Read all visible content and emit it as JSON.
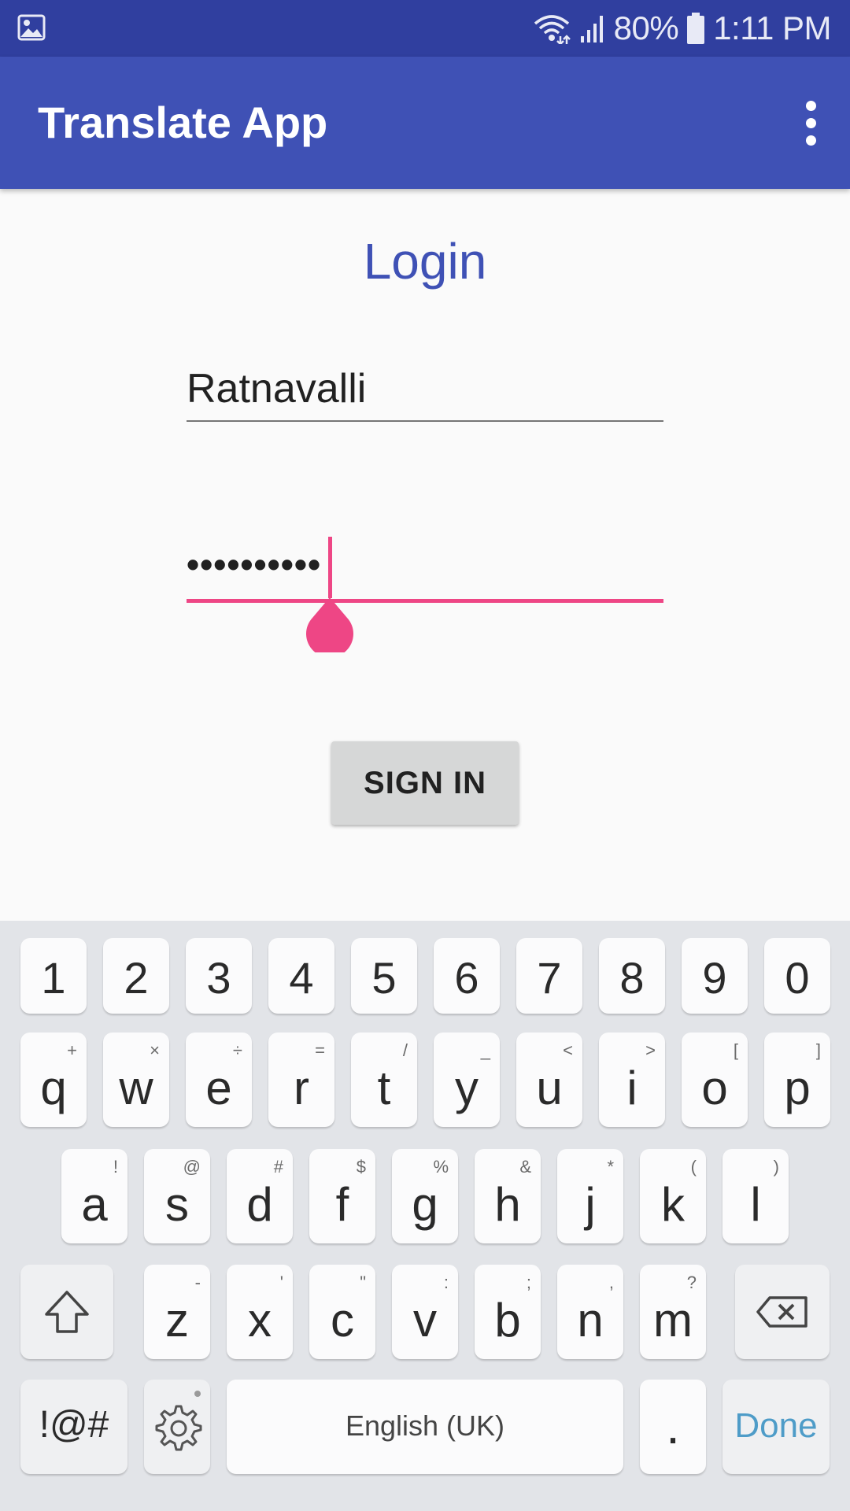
{
  "status_bar": {
    "battery": "80%",
    "time": "1:11 PM",
    "icons": [
      "image-icon",
      "wifi-icon",
      "signal-icon",
      "battery-icon"
    ]
  },
  "app_bar": {
    "title": "Translate App",
    "menu_icon": "more-vert-icon"
  },
  "login": {
    "title": "Login",
    "username_value": "Ratnavalli",
    "password_value": "••••••••••",
    "sign_in_label": "SIGN IN",
    "accent_color": "#ee4685",
    "primary_color": "#3f51b5"
  },
  "keyboard": {
    "numbers": [
      "1",
      "2",
      "3",
      "4",
      "5",
      "6",
      "7",
      "8",
      "9",
      "0"
    ],
    "row1": [
      {
        "key": "q",
        "hint": "+"
      },
      {
        "key": "w",
        "hint": "×"
      },
      {
        "key": "e",
        "hint": "÷"
      },
      {
        "key": "r",
        "hint": "="
      },
      {
        "key": "t",
        "hint": "/"
      },
      {
        "key": "y",
        "hint": "_"
      },
      {
        "key": "u",
        "hint": "<"
      },
      {
        "key": "i",
        "hint": ">"
      },
      {
        "key": "o",
        "hint": "["
      },
      {
        "key": "p",
        "hint": "]"
      }
    ],
    "row2": [
      {
        "key": "a",
        "hint": "!"
      },
      {
        "key": "s",
        "hint": "@"
      },
      {
        "key": "d",
        "hint": "#"
      },
      {
        "key": "f",
        "hint": "$"
      },
      {
        "key": "g",
        "hint": "%"
      },
      {
        "key": "h",
        "hint": "&"
      },
      {
        "key": "j",
        "hint": "*"
      },
      {
        "key": "k",
        "hint": "("
      },
      {
        "key": "l",
        "hint": ")"
      }
    ],
    "row3": [
      {
        "key": "z",
        "hint": "-"
      },
      {
        "key": "x",
        "hint": "'"
      },
      {
        "key": "c",
        "hint": "\""
      },
      {
        "key": "v",
        "hint": ":"
      },
      {
        "key": "b",
        "hint": ";"
      },
      {
        "key": "n",
        "hint": ","
      },
      {
        "key": "m",
        "hint": "?"
      }
    ],
    "symbols_label": "!@#",
    "space_label": "English (UK)",
    "period_label": ".",
    "done_label": "Done"
  }
}
